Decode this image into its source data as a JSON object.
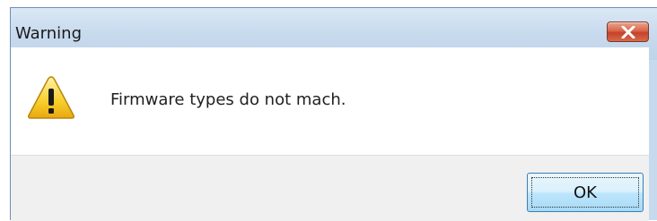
{
  "dialog": {
    "title": "Warning",
    "message": "Firmware types do not mach.",
    "ok_label": "OK",
    "icon": "warning-icon",
    "close_icon": "close-icon"
  },
  "colors": {
    "title_bar": "#c9dbee",
    "close_button": "#d9664a",
    "warning_yellow": "#f5c518",
    "button_border": "#3c7fb1"
  }
}
